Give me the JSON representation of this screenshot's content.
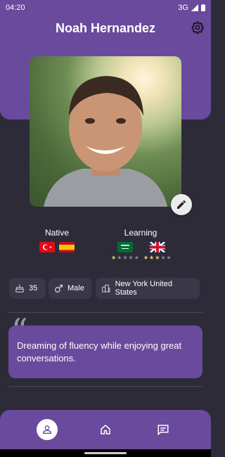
{
  "status_bar": {
    "time": "04:20",
    "network": "3G"
  },
  "header": {
    "title": "Noah Hernandez"
  },
  "profile_photo": {
    "description_icon": "profile-photo"
  },
  "languages": {
    "native_label": "Native",
    "native_flags": [
      "flag-turkey",
      "flag-spain"
    ],
    "learning_label": "Learning",
    "learning": [
      {
        "flag": "flag-saudi-arabia",
        "level": 1,
        "max": 5
      },
      {
        "flag": "flag-united-kingdom",
        "level": 3,
        "max": 5
      }
    ]
  },
  "info_chips": {
    "age": "35",
    "gender": "Male",
    "location": "New York United States"
  },
  "bio": {
    "text": "Dreaming of fluency while enjoying great conversations."
  },
  "bottom_nav": {
    "items": [
      "profile-icon",
      "home-icon",
      "chat-icon"
    ]
  },
  "colors": {
    "accent": "#6a4a9c",
    "background": "#2e2b38",
    "chip": "#3a3748",
    "star": "#f2d25e"
  }
}
